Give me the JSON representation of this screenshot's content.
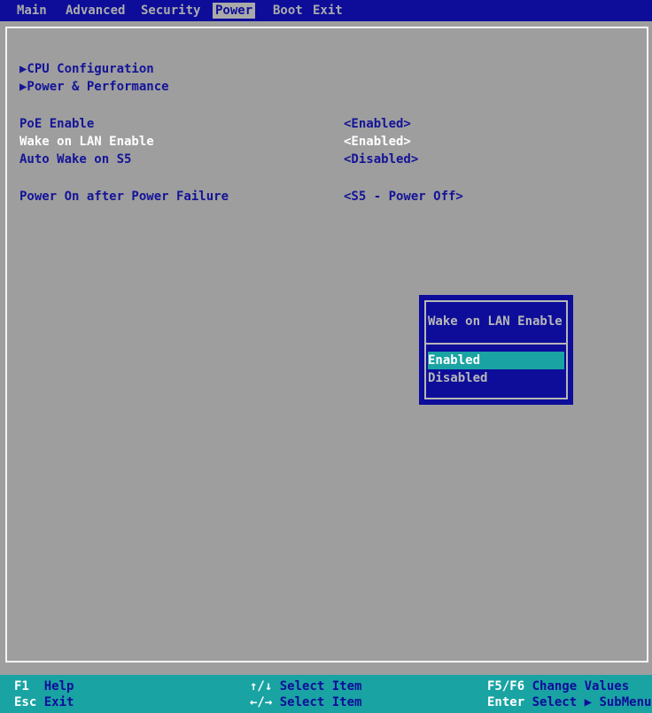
{
  "menu": {
    "items": [
      {
        "label": "Main",
        "active": false
      },
      {
        "label": "Advanced",
        "active": false
      },
      {
        "label": "Security",
        "active": false
      },
      {
        "label": "Power",
        "active": true
      },
      {
        "label": "Boot",
        "active": false
      },
      {
        "label": "Exit",
        "active": false
      }
    ]
  },
  "submenus": [
    {
      "label": "▶CPU Configuration"
    },
    {
      "label": "▶Power & Performance"
    }
  ],
  "settings": [
    {
      "label": "PoE Enable",
      "value": "<Enabled>"
    },
    {
      "label": "Wake on LAN Enable",
      "value": "<Enabled>",
      "selected": true
    },
    {
      "label": "Auto Wake on S5",
      "value": "<Disabled>"
    },
    {
      "label": "Power On after Power Failure",
      "value": "<S5 - Power Off>"
    }
  ],
  "popup": {
    "title": "Wake on LAN Enable",
    "options": [
      {
        "label": "Enabled",
        "highlight": true
      },
      {
        "label": "Disabled",
        "highlight": false
      }
    ]
  },
  "footer": {
    "row1": [
      {
        "key": "F1",
        "desc": "Help"
      },
      {
        "key": "↑/↓",
        "desc": "Select Item"
      },
      {
        "key": "F5/F6",
        "desc": "Change Values"
      }
    ],
    "row2": [
      {
        "key": "Esc",
        "desc": "Exit"
      },
      {
        "key": "←/→",
        "desc": "Select Item"
      },
      {
        "key": "Enter",
        "desc": "Select ▶ SubMenu"
      }
    ]
  },
  "colors": {
    "background": "#9e9e9e",
    "menubar": "#0d0d9a",
    "accent": "#1aa3a3",
    "text_blue": "#141498",
    "text_white": "#ffffff"
  }
}
